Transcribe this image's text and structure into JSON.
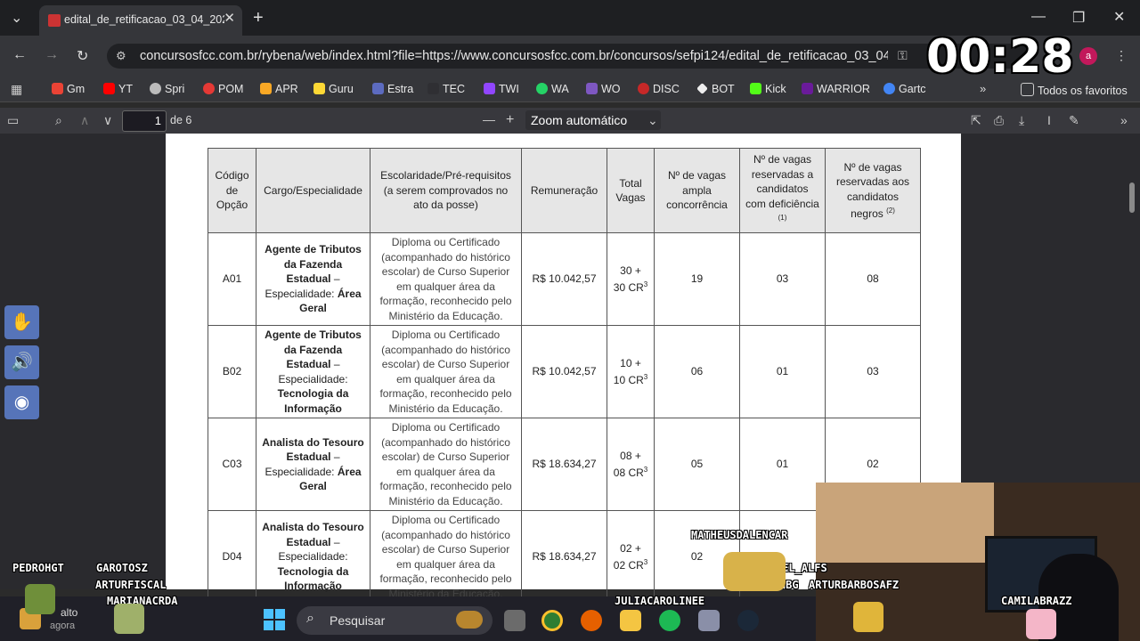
{
  "browser": {
    "tab_title": "edital_de_retificacao_03_04_202",
    "url": "concursosfcc.com.br/rybena/web/index.html?file=https://www.concursosfcc.com.br/concursos/sefpi124/edital_de_retificacao_03_04_2...",
    "avatar_letter": "a",
    "bookmarks": [
      "Gm",
      "YT",
      "Spri",
      "POM",
      "APR",
      "Guru",
      "Estra",
      "TEC",
      "TWI",
      "WA",
      "WO",
      "DISC",
      "BOT",
      "Kick",
      "WARRIOR",
      "Gartc"
    ],
    "all_bookmarks_label": "Todos os favoritos"
  },
  "pdf_toolbar": {
    "page": "1",
    "page_total": "de 6",
    "zoom": "Zoom automático"
  },
  "table": {
    "headers": [
      "Código de Opção",
      "Cargo/Especialidade",
      "Escolaridade/Pré-requisitos (a serem comprovados no ato da posse)",
      "Remuneração",
      "Total Vagas",
      "Nº de vagas ampla concorrência",
      "Nº de vagas reservadas a candidatos com deficiência",
      "Nº de vagas reservadas aos candidatos negros"
    ],
    "header_sup_def": "(1)",
    "header_sup_neg": "(2)",
    "rows": [
      {
        "code": "A01",
        "cargo_bold": "Agente de Tributos da Fazenda Estadual",
        "cargo_dash": "– Especialidade:",
        "cargo_spec": "Área Geral",
        "esc": "Diploma ou Certificado (acompanhado do histórico escolar) de Curso Superior em qualquer área da formação, reconhecido pelo Ministério da Educação.",
        "rem": "R$ 10.042,57",
        "total": "30 + 30 CR",
        "total_sup": "3",
        "ampla": "19",
        "def": "03",
        "neg": "08"
      },
      {
        "code": "B02",
        "cargo_bold": "Agente de Tributos da Fazenda Estadual",
        "cargo_dash": "– Especialidade:",
        "cargo_spec": "Tecnologia da Informação",
        "esc": "Diploma ou Certificado (acompanhado do histórico escolar) de Curso Superior em qualquer área da formação, reconhecido pelo Ministério da Educação.",
        "rem": "R$ 10.042,57",
        "total": "10 + 10 CR",
        "total_sup": "3",
        "ampla": "06",
        "def": "01",
        "neg": "03"
      },
      {
        "code": "C03",
        "cargo_bold": "Analista do Tesouro Estadual",
        "cargo_dash": "– Especialidade:",
        "cargo_spec": "Área Geral",
        "esc": "Diploma ou Certificado (acompanhado do histórico escolar) de Curso Superior em qualquer área da formação, reconhecido pelo Ministério da Educação.",
        "rem": "R$ 18.634,27",
        "total": "08 + 08 CR",
        "total_sup": "3",
        "ampla": "05",
        "def": "01",
        "neg": "02"
      },
      {
        "code": "D04",
        "cargo_bold": "Analista do Tesouro Estadual",
        "cargo_dash": "– Especialidade:",
        "cargo_spec": "Tecnologia da Informação",
        "esc": "Diploma ou Certificado (acompanhado do histórico escolar) de Curso Superior em qualquer área da formação, reconhecido pelo Ministério da Educação.",
        "rem": "R$ 18.634,27",
        "total": "02 + 02 CR",
        "total_sup": "3",
        "ampla": "02",
        "def": "-",
        "neg": ""
      }
    ]
  },
  "overlay": {
    "timer": "00:28",
    "nicknames": [
      "PEDROHGT",
      "GAROTOSZ",
      "ARTURFISCAL",
      "MARIANACRDA",
      "MATHEUSDALENCAR",
      "GABRIEL_ALFS",
      "VINIHBG",
      "ARTURBARBOSAFZ",
      "JULIACAROLINEE",
      "CAMILABRAZZ"
    ]
  },
  "taskbar": {
    "search_placeholder": "Pesquisar",
    "notify_line1": "alto",
    "notify_line2": "agora"
  },
  "colors": {
    "accent_tab": "#cc3333",
    "accessibility": "#5674b9",
    "taskbar": "#202028"
  }
}
